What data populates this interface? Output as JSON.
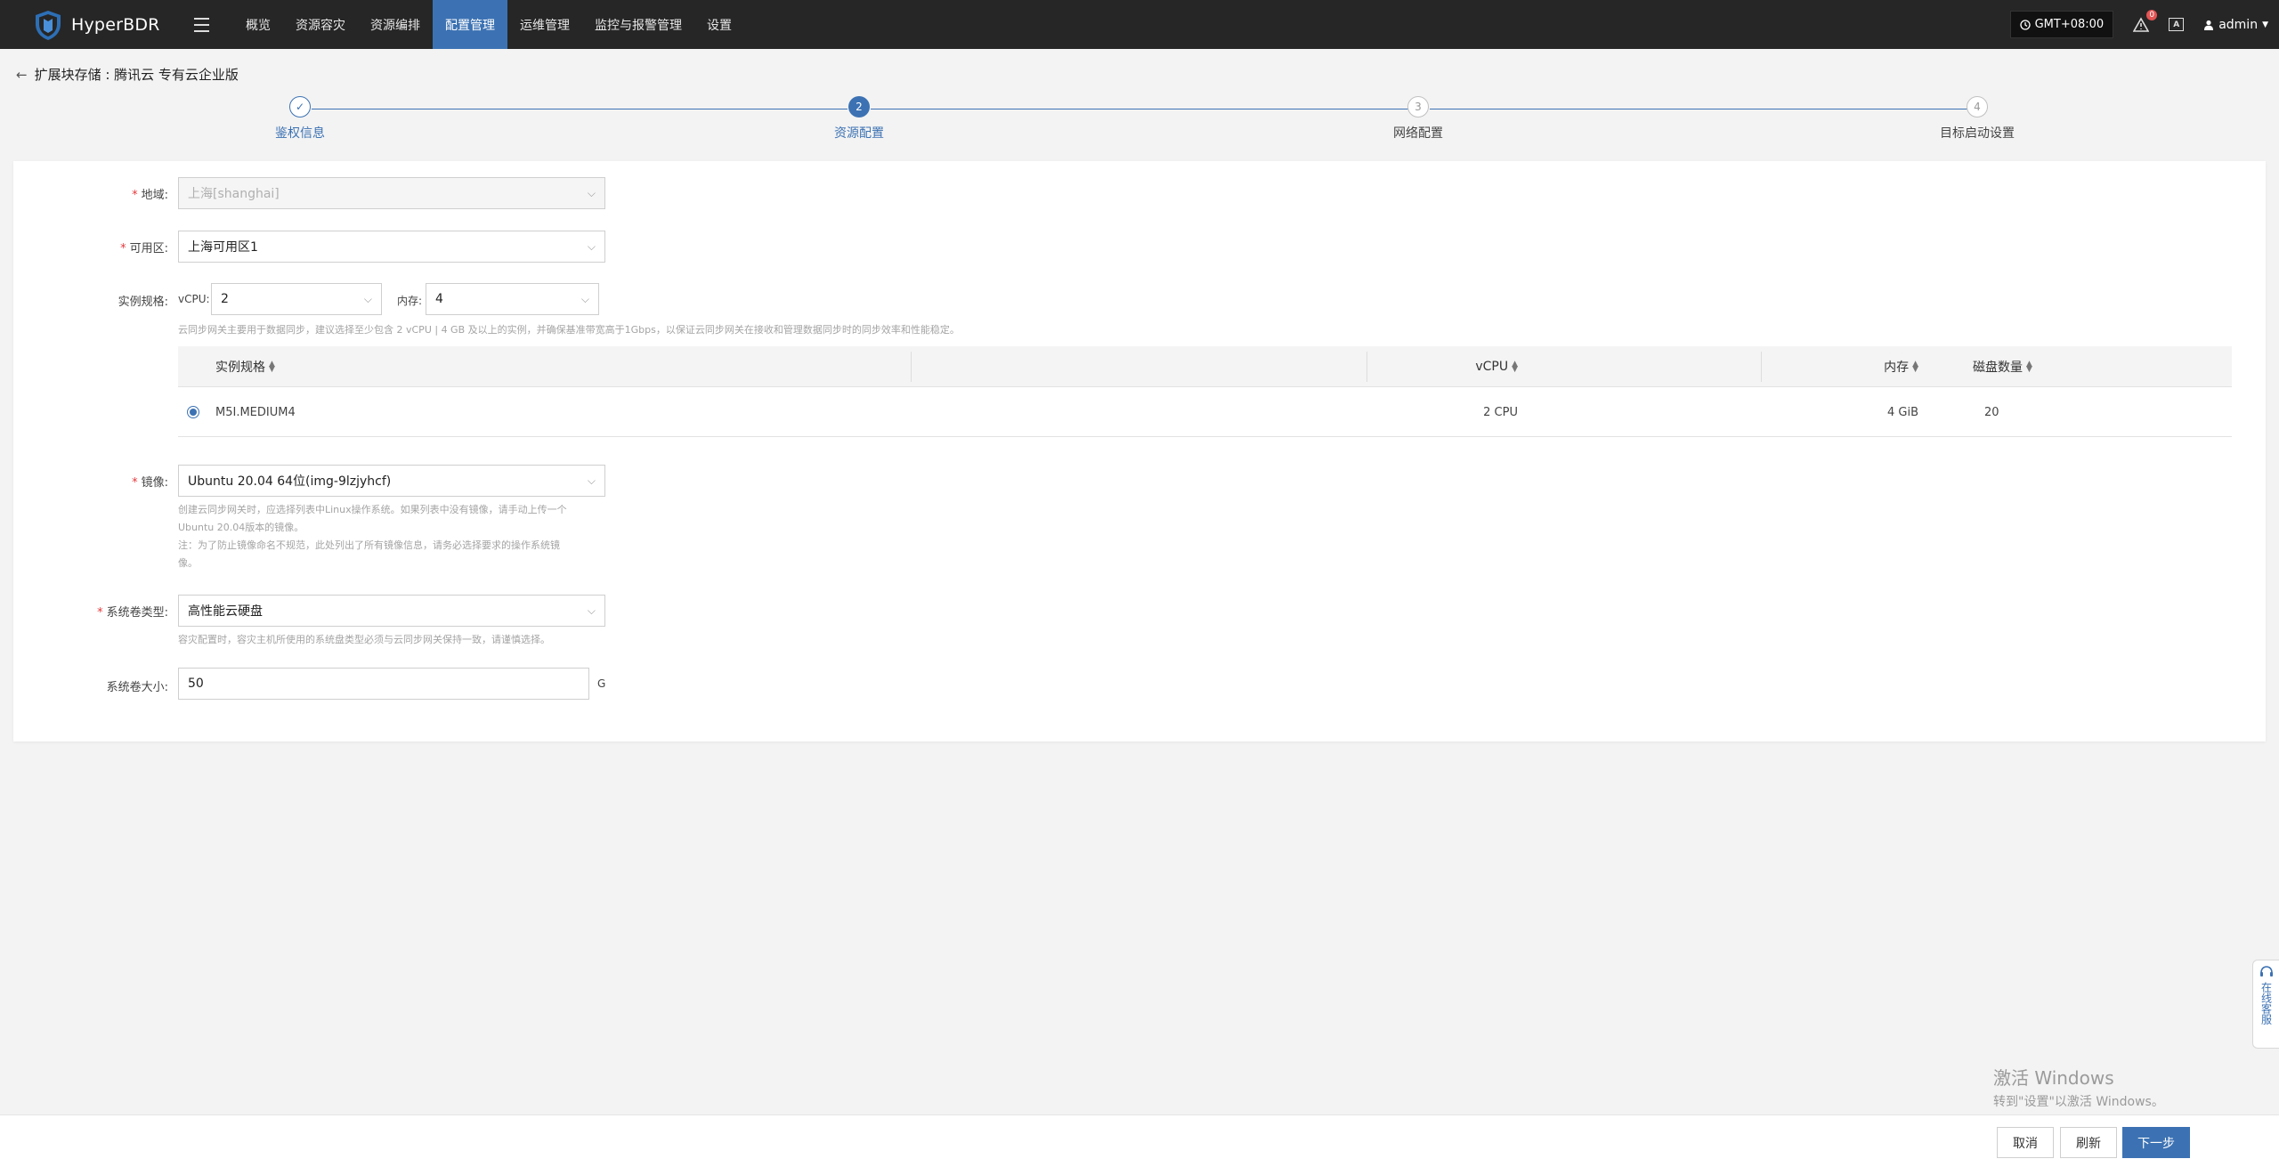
{
  "app": {
    "name": "HyperBDR"
  },
  "nav": {
    "items": [
      {
        "label": "概览",
        "active": false
      },
      {
        "label": "资源容灾",
        "active": false
      },
      {
        "label": "资源编排",
        "active": false
      },
      {
        "label": "配置管理",
        "active": true
      },
      {
        "label": "运维管理",
        "active": false
      },
      {
        "label": "监控与报警管理",
        "active": false
      },
      {
        "label": "设置",
        "active": false
      }
    ],
    "timezone": "GMT+08:00",
    "alert_count": "0",
    "font_icon": "A",
    "user": "admin"
  },
  "breadcrumb": {
    "text": "扩展块存储 : 腾讯云 专有云企业版"
  },
  "steps": [
    {
      "number": "✓",
      "label": "鉴权信息",
      "state": "done"
    },
    {
      "number": "2",
      "label": "资源配置",
      "state": "active"
    },
    {
      "number": "3",
      "label": "网络配置",
      "state": "pending"
    },
    {
      "number": "4",
      "label": "目标启动设置",
      "state": "pending"
    }
  ],
  "form": {
    "region": {
      "label": "地域:",
      "value": "上海[shanghai]"
    },
    "zone": {
      "label": "可用区:",
      "value": "上海可用区1"
    },
    "spec": {
      "label": "实例规格:",
      "vcpu_label": "vCPU:",
      "vcpu_value": "2",
      "memory_label": "内存:",
      "memory_value": "4",
      "hint": "云同步网关主要用于数据同步，建议选择至少包含 2 vCPU | 4 GB 及以上的实例，并确保基准带宽高于1Gbps，以保证云同步网关在接收和管理数据同步时的同步效率和性能稳定。"
    },
    "table": {
      "headers": [
        "实例规格",
        "vCPU",
        "内存",
        "磁盘数量"
      ],
      "rows": [
        {
          "name": "M5I.MEDIUM4",
          "vcpu": "2 CPU",
          "memory": "4 GiB",
          "disks": "20"
        }
      ]
    },
    "image": {
      "label": "镜像:",
      "value": "Ubuntu 20.04 64位(img-9lzjyhcf)",
      "hint1": "创建云同步网关时，应选择列表中Linux操作系统。如果列表中没有镜像，请手动上传一个",
      "hint2": "Ubuntu 20.04版本的镜像。",
      "hint3": "注：为了防止镜像命名不规范，此处列出了所有镜像信息，请务必选择要求的操作系统镜",
      "hint4": "像。"
    },
    "disk_type": {
      "label": "系统卷类型:",
      "value": "高性能云硬盘",
      "hint": "容灾配置时，容灾主机所使用的系统盘类型必须与云同步网关保持一致，请谨慎选择。"
    },
    "disk_size": {
      "label": "系统卷大小:",
      "value": "50",
      "unit": "G"
    }
  },
  "footer": {
    "cancel": "取消",
    "refresh": "刷新",
    "next": "下一步"
  },
  "watermark": {
    "line1": "激活 Windows",
    "line2": "转到\"设置\"以激活 Windows。"
  },
  "side_help": {
    "label": "在线客服"
  },
  "colors": {
    "primary": "#3c72b3",
    "topbar": "#262626",
    "required": "#e4393c"
  }
}
